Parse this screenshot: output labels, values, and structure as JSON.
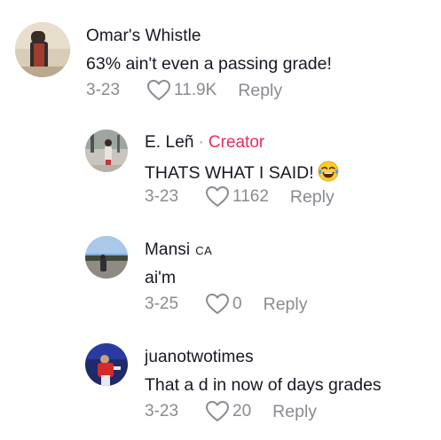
{
  "comments": [
    {
      "name": "Omar's Whistle",
      "text": "63% ain't even a passing grade!",
      "date": "3-23",
      "likes": "11.9K",
      "reply_label": "Reply",
      "avatar_icon": "user-avatar"
    },
    {
      "name": "E. Leñ",
      "dot": "·",
      "badge": "Creator",
      "text": "THATS WHAT I SAID!",
      "emoji": "face-with-tears-of-joy",
      "date": "3-23",
      "likes": "1162",
      "reply_label": "Reply",
      "avatar_icon": "user-avatar"
    },
    {
      "name": "Mansi",
      "region": "CA",
      "text": "ai'm",
      "date": "3-25",
      "likes": "0",
      "reply_label": "Reply",
      "avatar_icon": "user-avatar"
    },
    {
      "name": "juanotwotimes",
      "text": "That a d in now of days grades",
      "date": "3-23",
      "likes": "20",
      "reply_label": "Reply",
      "avatar_icon": "user-avatar"
    }
  ],
  "colors": {
    "text": "#161823",
    "muted": "#8a8b91",
    "creator": "#ea2c5d"
  }
}
